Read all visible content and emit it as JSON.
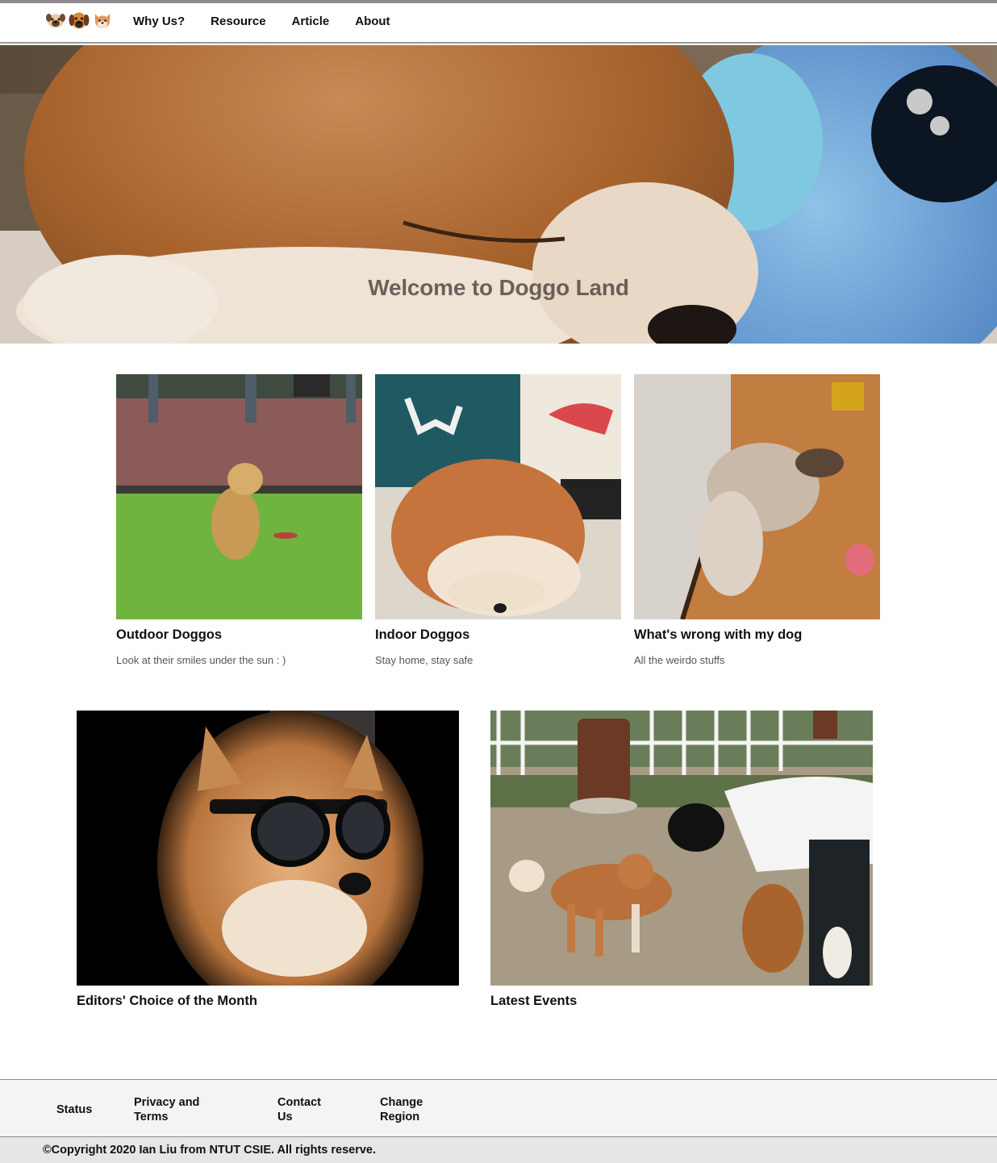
{
  "nav": {
    "logo_icons": [
      "pug-face-icon",
      "dog-face-icon",
      "dog-face-icon"
    ],
    "links": [
      {
        "label": "Why Us?"
      },
      {
        "label": "Resource"
      },
      {
        "label": "Article"
      },
      {
        "label": "About"
      }
    ]
  },
  "hero": {
    "title": "Welcome to Doggo Land"
  },
  "cards": [
    {
      "title": "Outdoor Doggos",
      "description": "Look at their smiles under the sun : )"
    },
    {
      "title": "Indoor Doggos",
      "description": "Stay home, stay safe"
    },
    {
      "title": "What's wrong with my dog",
      "description": "All the weirdo stuffs"
    }
  ],
  "features": [
    {
      "title": "Editors' Choice of the Month"
    },
    {
      "title": "Latest Events"
    }
  ],
  "footer": {
    "links": [
      {
        "line1": "Status",
        "line2": ""
      },
      {
        "line1": "Privacy and",
        "line2": "Terms"
      },
      {
        "line1": "Contact",
        "line2": "Us"
      },
      {
        "line1": "Change",
        "line2": "Region"
      }
    ],
    "copyright": "©Copyright 2020 Ian Liu from NTUT CSIE. All rights reserve."
  }
}
